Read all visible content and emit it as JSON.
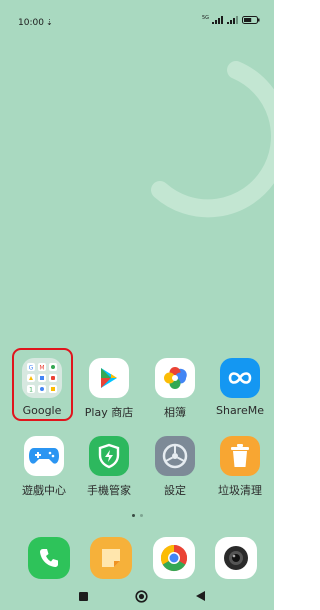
{
  "status_bar": {
    "time": "10:00",
    "network_label": "5G",
    "battery_level": 0.6
  },
  "apps_row1": [
    {
      "label": "Google",
      "icon": "google-folder-icon"
    },
    {
      "label": "Play 商店",
      "icon": "play-store-icon"
    },
    {
      "label": "相簿",
      "icon": "photos-icon"
    },
    {
      "label": "ShareMe",
      "icon": "shareme-icon"
    }
  ],
  "apps_row2": [
    {
      "label": "遊戲中心",
      "icon": "game-center-icon"
    },
    {
      "label": "手機管家",
      "icon": "security-icon"
    },
    {
      "label": "設定",
      "icon": "settings-icon"
    },
    {
      "label": "垃圾清理",
      "icon": "cleaner-icon"
    }
  ],
  "dock": [
    {
      "icon": "phone-icon"
    },
    {
      "icon": "notes-icon"
    },
    {
      "icon": "chrome-icon"
    },
    {
      "icon": "camera-icon"
    }
  ],
  "page_indicator": {
    "pages": 2,
    "current": 0
  },
  "colors": {
    "wallpaper": "#a9d9c0",
    "highlight": "#e0151d",
    "phone": "#2ec35a",
    "notes": "#f6b13a",
    "shareme": "#1497f2",
    "game": "#2b95f2",
    "security": "#2db85e",
    "cleaner": "#f8a632"
  }
}
